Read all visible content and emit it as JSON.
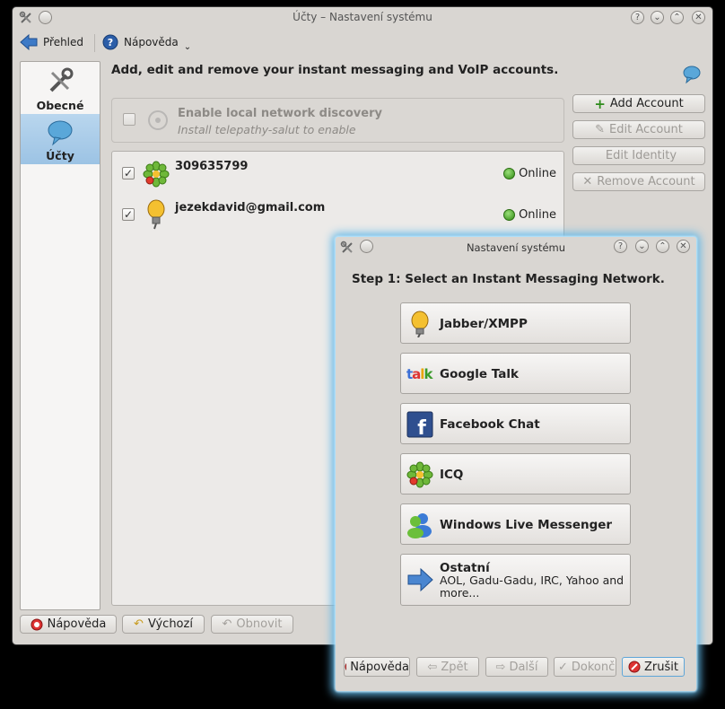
{
  "main_window": {
    "title": "Účty – Nastavení systému",
    "toolbar": {
      "overview_label": "Přehled",
      "help_label": "Nápověda"
    },
    "sidebar": {
      "items": [
        {
          "label": "Obecné"
        },
        {
          "label": "Účty"
        }
      ]
    },
    "header": "Add, edit and remove your instant messaging and VoIP accounts.",
    "discovery": {
      "title": "Enable local network discovery",
      "subtitle": "Install telepathy-salut to enable"
    },
    "accounts": [
      {
        "name": "309635799",
        "status": "Online",
        "network": "icq"
      },
      {
        "name": "jezekdavid@gmail.com",
        "status": "Online",
        "network": "jabber"
      }
    ],
    "side_buttons": {
      "add": "Add Account",
      "edit": "Edit Account",
      "identity": "Edit Identity",
      "remove": "Remove Account"
    },
    "bottom_buttons": {
      "help": "Nápověda",
      "defaults": "Výchozí",
      "reset": "Obnovit"
    }
  },
  "dialog": {
    "title": "Nastavení systému",
    "step": "Step 1: Select an Instant Messaging Network.",
    "networks": [
      {
        "label": "Jabber/XMPP",
        "icon": "jabber-icon"
      },
      {
        "label": "Google Talk",
        "icon": "google-talk-icon"
      },
      {
        "label": "Facebook Chat",
        "icon": "facebook-icon"
      },
      {
        "label": "ICQ",
        "icon": "icq-icon"
      },
      {
        "label": "Windows Live Messenger",
        "icon": "msn-icon"
      },
      {
        "label": "Ostatní",
        "sub1": "AOL, Gadu-Gadu, IRC, Yahoo and",
        "sub2": "more...",
        "icon": "arrow-right-icon"
      }
    ],
    "buttons": {
      "help": "Nápověda",
      "back": "Zpět",
      "next": "Další",
      "finish": "Dokončit",
      "cancel": "Zrušit"
    }
  },
  "colors": {
    "online": "#2f8a12",
    "glow": "#5fb7e8",
    "window_bg": "#d9d6d2"
  }
}
